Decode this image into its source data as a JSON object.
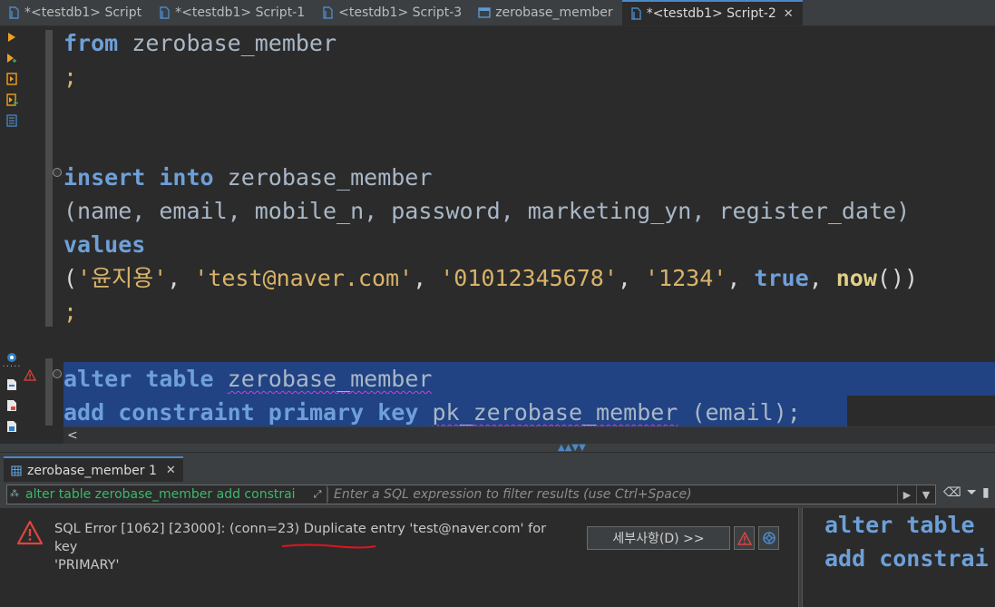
{
  "tabs": [
    {
      "label": "*<testdb1> Script",
      "icon": "sql-script-icon"
    },
    {
      "label": "*<testdb1> Script-1",
      "icon": "sql-script-icon"
    },
    {
      "label": "<testdb1> Script-3",
      "icon": "sql-script-icon"
    },
    {
      "label": "zerobase_member",
      "icon": "table-icon"
    },
    {
      "label": "*<testdb1> Script-2",
      "icon": "sql-script-icon",
      "active": true
    }
  ],
  "code": {
    "l1": {
      "kw": "from",
      "rest": " zerobase_member"
    },
    "l2": ";",
    "l5": {
      "kw1": "insert",
      "kw2": "into",
      "rest": " zerobase_member"
    },
    "l6": "(name, email, mobile_n, password, marketing_yn, register_date)",
    "l7": "values",
    "l8": {
      "open": "(",
      "s1": "'윤지용'",
      "c1": ", ",
      "s2": "'test@naver.com'",
      "c2": ", ",
      "s3": "'01012345678'",
      "c3": ", ",
      "s4": "'1234'",
      "c4": ", ",
      "kwtrue": "true",
      "c5": ", ",
      "fn": "now",
      "close": "())"
    },
    "l9": ";",
    "l11": {
      "kw1": "alter",
      "kw2": "table",
      "rest": "zerobase_member"
    },
    "l12": {
      "kw1": "add",
      "kw2": "constraint",
      "kw3": "primary",
      "kw4": "key",
      "id": "pk_zerobase_member",
      "rest": " (email);"
    }
  },
  "scroll_left": "<",
  "results": {
    "tab_label": "zerobase_member 1",
    "filter_sql": "alter table zerobase_member add constrai",
    "filter_placeholder": "Enter a SQL expression to filter results (use Ctrl+Space)",
    "error_line1_a": "SQL Error [1062] [23000]: (conn=23) ",
    "error_line1_b": "Duplicate entry",
    "error_line1_c": " 'test@naver.com' for key",
    "error_line2": "'PRIMARY'",
    "details_button": "세부사항(D) >>",
    "sql_line1": "alter table",
    "sql_line2": "add constrai"
  },
  "colors": {
    "accent": "#4a88c7",
    "selection": "#214283",
    "error": "#e0443e",
    "keyword": "#6ea0d8",
    "string": "#d9b36a"
  }
}
